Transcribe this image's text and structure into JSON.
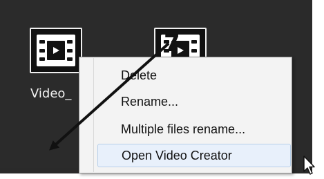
{
  "file": {
    "name": "Video_",
    "icon": "video-file-icon"
  },
  "context_menu": {
    "items": [
      {
        "label": "Delete"
      },
      {
        "label": "Rename..."
      },
      {
        "label": "Multiple files rename..."
      },
      {
        "label": "Open Video Creator",
        "highlighted": true
      }
    ]
  },
  "annotation": {
    "step_number": "7",
    "arrow_icon": "diagonal-arrow-icon"
  },
  "cursor": {
    "icon": "mouse-pointer-icon"
  },
  "colors": {
    "background": "#2b2b2b",
    "menu_background": "#f3f3f3",
    "highlight": "#e8f0fb",
    "highlight_border": "#b7cfe9",
    "arrow": "#111111"
  }
}
